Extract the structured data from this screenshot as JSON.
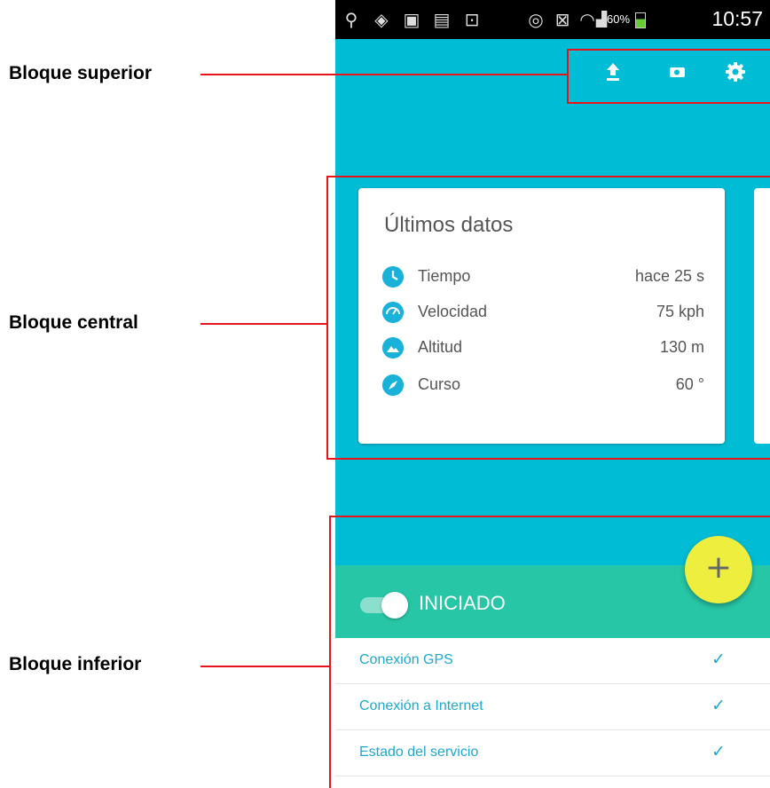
{
  "annotations": {
    "top_block": "Bloque superior",
    "central_block": "Bloque central",
    "bottom_block": "Bloque inferior"
  },
  "status_bar": {
    "battery": "60%",
    "time": "10:57",
    "icons": [
      "location-icon",
      "gps-icon",
      "gallery-icon",
      "file-icon",
      "shopping-bag-icon",
      "eye-icon",
      "nfc-icon",
      "wifi-icon",
      "signal-icon",
      "battery-icon"
    ]
  },
  "toolbar": {
    "icons": [
      "upload-icon",
      "camera-icon",
      "settings-icon"
    ]
  },
  "card": {
    "title": "Últimos datos",
    "rows": [
      {
        "icon": "clock-icon",
        "label": "Tiempo",
        "value": "hace 25 s"
      },
      {
        "icon": "speedometer-icon",
        "label": "Velocidad",
        "value": "75 kph"
      },
      {
        "icon": "mountain-icon",
        "label": "Altitud",
        "value": "130 m"
      },
      {
        "icon": "compass-icon",
        "label": "Curso",
        "value": "60 °"
      }
    ]
  },
  "fab": {
    "label": "+"
  },
  "service": {
    "toggle_on": true,
    "status": "INICIADO"
  },
  "checks": [
    {
      "label": "Conexión GPS",
      "mark": "✓"
    },
    {
      "label": "Conexión a Internet",
      "mark": "✓"
    },
    {
      "label": "Estado del servicio",
      "mark": "✓"
    }
  ],
  "colors": {
    "appbar": "#00bcd4",
    "green_bar": "#26c6a6",
    "fab": "#eeee3f",
    "accent_text": "#1fa8cf",
    "annotation_red": "#e8141b"
  }
}
